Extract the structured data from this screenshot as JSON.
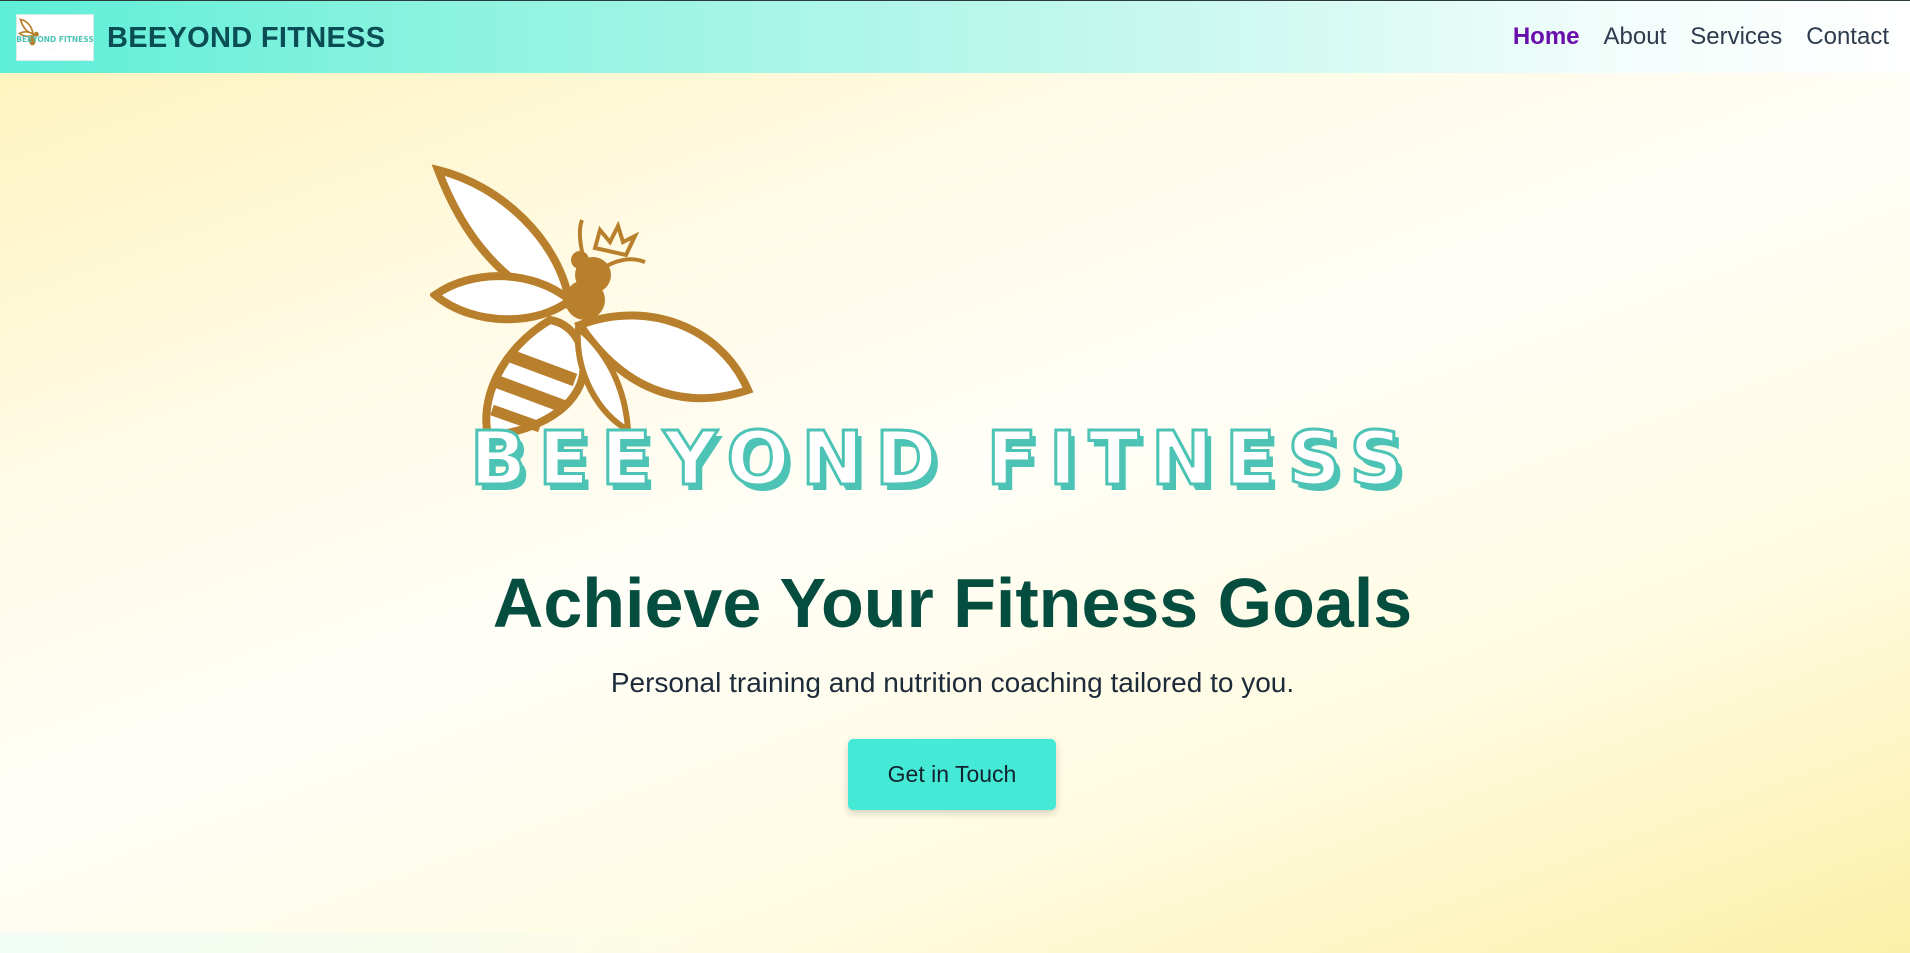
{
  "nav": {
    "brand": "BEEYOND FITNESS",
    "logo_text": "BEEYOND FITNESS",
    "links": [
      {
        "label": "Home",
        "active": true
      },
      {
        "label": "About",
        "active": false
      },
      {
        "label": "Services",
        "active": false
      },
      {
        "label": "Contact",
        "active": false
      }
    ]
  },
  "hero": {
    "logo_wordmark": "BEEYOND FITNESS",
    "title": "Achieve Your Fitness Goals",
    "subtitle": "Personal training and nutrition coaching tailored to you.",
    "cta_label": "Get in Touch"
  },
  "colors": {
    "nav_gradient_start": "#5deed8",
    "brand_text": "#0b4d55",
    "active_link": "#6a0dad",
    "bee_gold": "#b8802c",
    "wordmark_teal": "#4cc3b4",
    "title_green": "#054d3f",
    "cta_bg": "#44ead5"
  },
  "icons": {
    "nav_logo": "bee-logo-icon",
    "hero_logo": "bee-crown-icon"
  }
}
